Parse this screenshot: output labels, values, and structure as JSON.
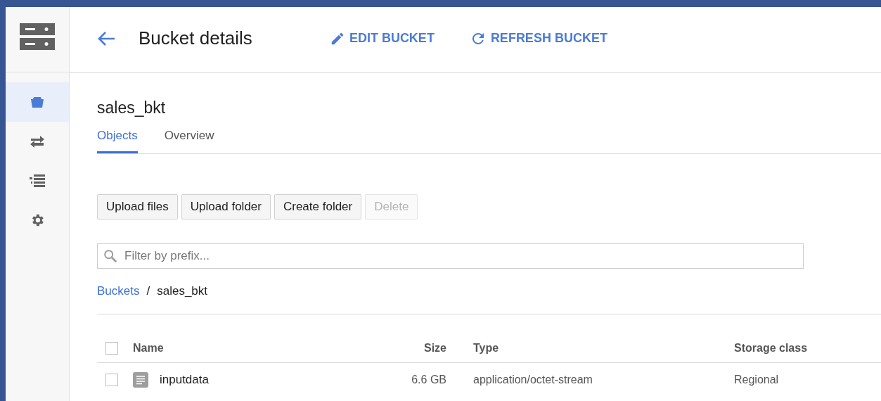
{
  "header": {
    "title": "Bucket details",
    "actions": [
      {
        "kind": "edit",
        "label": "EDIT BUCKET"
      },
      {
        "kind": "refresh",
        "label": "REFRESH BUCKET"
      }
    ]
  },
  "sidebar": {
    "items": [
      {
        "kind": "bucket",
        "selected": true
      },
      {
        "kind": "transfer",
        "selected": false
      },
      {
        "kind": "list",
        "selected": false
      },
      {
        "kind": "settings",
        "selected": false
      }
    ]
  },
  "bucket": {
    "name": "sales_bkt",
    "tabs": [
      {
        "label": "Objects",
        "selected": true
      },
      {
        "label": "Overview",
        "selected": false
      }
    ],
    "buttons": [
      {
        "label": "Upload files",
        "disabled": false
      },
      {
        "label": "Upload folder",
        "disabled": false
      },
      {
        "label": "Create folder",
        "disabled": false
      },
      {
        "label": "Delete",
        "disabled": true
      }
    ],
    "filter": {
      "placeholder": "Filter by prefix..."
    },
    "breadcrumb_separator": "/",
    "breadcrumb": [
      {
        "label": "Buckets",
        "link": true
      },
      {
        "label": "sales_bkt",
        "link": false
      }
    ],
    "table": {
      "select_all": {
        "checked": false
      },
      "columns": [
        "Name",
        "Size",
        "Type",
        "Storage class"
      ],
      "rows": [
        {
          "checked": false,
          "kind": "file",
          "name": "inputdata",
          "size": "6.6 GB",
          "type": "application/octet-stream",
          "storage_class": "Regional"
        }
      ]
    }
  }
}
